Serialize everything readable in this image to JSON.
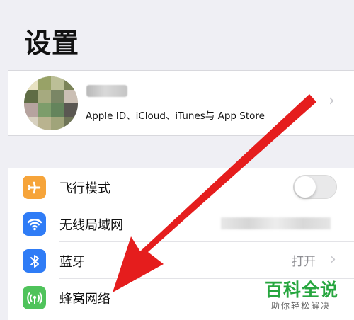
{
  "header": {
    "title": "设置"
  },
  "profile": {
    "apple_id_text": "Apple ID、iCloud、iTunes与 App Store",
    "chevron": "›"
  },
  "settings": {
    "rows": [
      {
        "label": "飞行模式",
        "icon": "airplane-icon",
        "icon_color": "#f6a43a",
        "toggle_on": false
      },
      {
        "label": "无线局域网",
        "icon": "wifi-icon",
        "icon_color": "#2f7cf6"
      },
      {
        "label": "蓝牙",
        "icon": "bluetooth-icon",
        "icon_color": "#2f7cf6",
        "value": "打开",
        "chevron": "›"
      },
      {
        "label": "蜂窝网络",
        "icon": "cellular-icon",
        "icon_color": "#4fc35b"
      }
    ]
  },
  "watermark": {
    "main": "百科全说",
    "sub": "助你轻松解决"
  },
  "colors": {
    "background": "#efeff4",
    "annotation_arrow": "#e51d1d",
    "watermark": "#27a63f"
  }
}
